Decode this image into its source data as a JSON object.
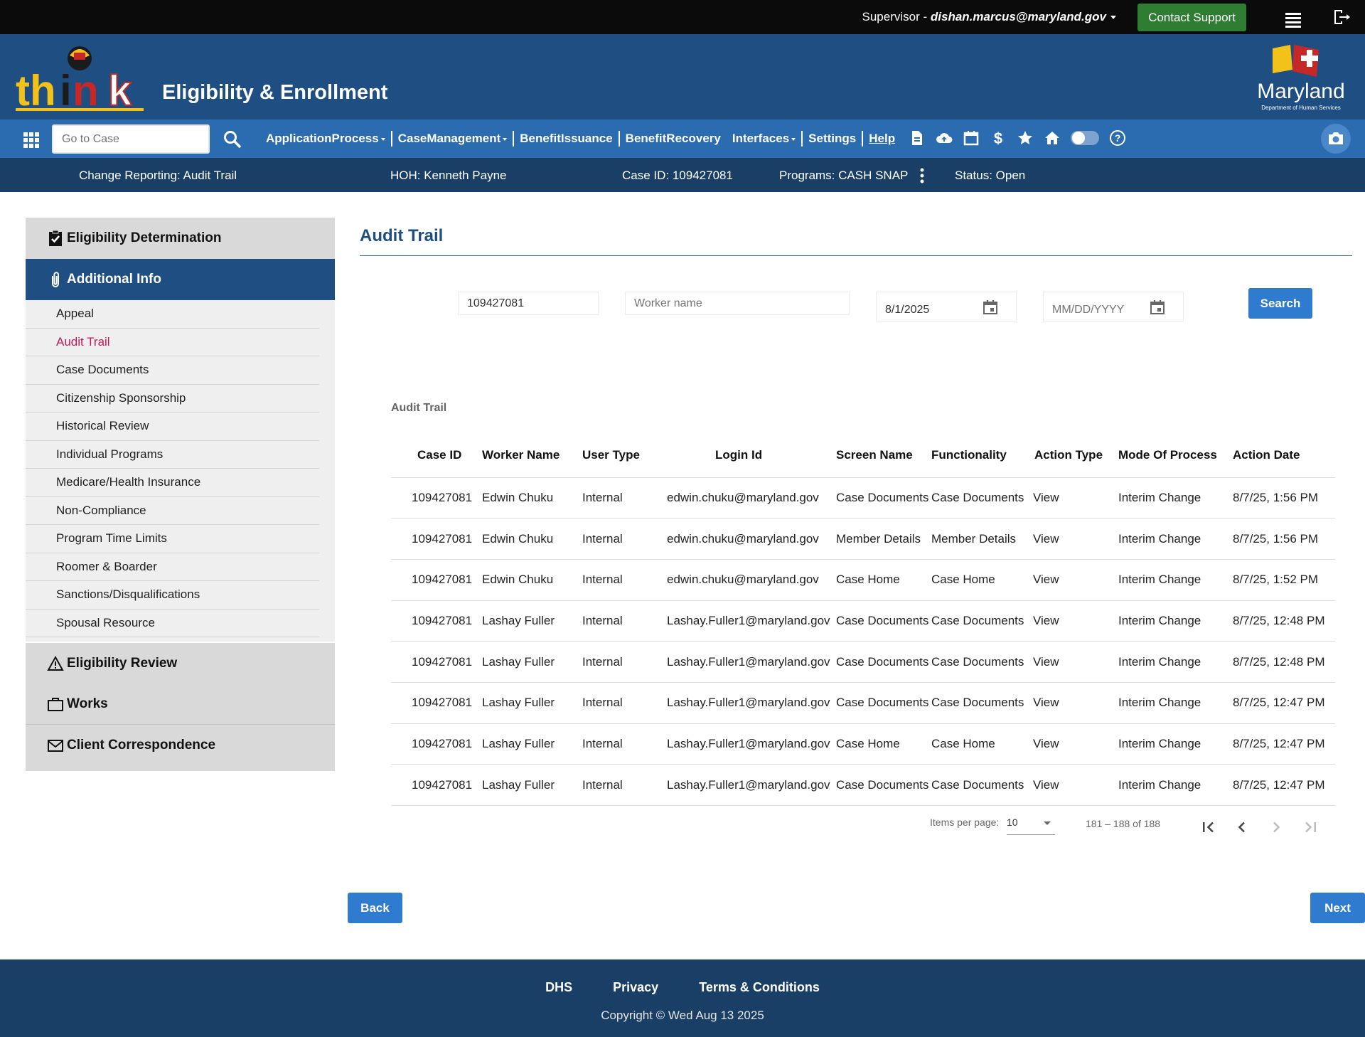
{
  "topbar": {
    "role_label": "Supervisor - ",
    "email": "dishan.marcus@maryland.gov",
    "contact_label": "Contact Support"
  },
  "header": {
    "title": "Eligibility & Enrollment",
    "logo_text": "think",
    "state_logo_text": "Maryland",
    "state_logo_subtext": "Department of Human Services"
  },
  "navbar": {
    "goto_placeholder": "Go to Case",
    "menu": [
      {
        "label": "ApplicationProcess"
      },
      {
        "label": "CaseManagement"
      },
      {
        "label": "BenefitIssuance"
      },
      {
        "label": "BenefitRecovery"
      },
      {
        "label": "Interfaces"
      },
      {
        "label": "Settings"
      },
      {
        "label": "Help"
      }
    ]
  },
  "casebar": {
    "page": "Change Reporting: Audit Trail",
    "hoh": "HOH: Kenneth Payne",
    "case_id": "Case ID: 109427081",
    "programs": "Programs: CASH  SNAP",
    "status": "Status: Open"
  },
  "sidebar": {
    "eligibility_determination": "Eligibility Determination",
    "additional_info": "Additional Info",
    "links": [
      "Appeal",
      "Audit Trail",
      "Case Documents",
      "Citizenship Sponsorship",
      "Historical Review",
      "Individual Programs",
      "Medicare/Health Insurance",
      "Non-Compliance",
      "Program Time Limits",
      "Roomer & Boarder",
      "Sanctions/Disqualifications",
      "Spousal Resource"
    ],
    "eligibility_review": "Eligibility Review",
    "works": "Works",
    "client_correspondence": "Client Correspondence"
  },
  "main": {
    "heading": "Audit Trail",
    "filters": {
      "case_id_value": "109427081",
      "worker_placeholder": "Worker name",
      "from_date_value": "8/1/2025",
      "to_date_placeholder": "MM/DD/YYYY",
      "search_label": "Search"
    },
    "table_label": "Audit Trail",
    "columns": [
      "Case ID",
      "Worker Name",
      "User Type",
      "Login Id",
      "Screen Name",
      "Functionality",
      "Action Type",
      "Mode Of Process",
      "Action Date"
    ],
    "rows": [
      [
        "109427081",
        "Edwin Chuku",
        "Internal",
        "edwin.chuku@maryland.gov",
        "Case Documents",
        "Case Documents",
        "View",
        "Interim Change",
        "8/7/25, 1:56 PM"
      ],
      [
        "109427081",
        "Edwin Chuku",
        "Internal",
        "edwin.chuku@maryland.gov",
        "Member Details",
        "Member Details",
        "View",
        "Interim Change",
        "8/7/25, 1:56 PM"
      ],
      [
        "109427081",
        "Edwin Chuku",
        "Internal",
        "edwin.chuku@maryland.gov",
        "Case Home",
        "Case Home",
        "View",
        "Interim Change",
        "8/7/25, 1:52 PM"
      ],
      [
        "109427081",
        "Lashay Fuller",
        "Internal",
        "Lashay.Fuller1@maryland.gov",
        "Case Documents",
        "Case Documents",
        "View",
        "Interim Change",
        "8/7/25, 12:48 PM"
      ],
      [
        "109427081",
        "Lashay Fuller",
        "Internal",
        "Lashay.Fuller1@maryland.gov",
        "Case Documents",
        "Case Documents",
        "View",
        "Interim Change",
        "8/7/25, 12:48 PM"
      ],
      [
        "109427081",
        "Lashay Fuller",
        "Internal",
        "Lashay.Fuller1@maryland.gov",
        "Case Documents",
        "Case Documents",
        "View",
        "Interim Change",
        "8/7/25, 12:47 PM"
      ],
      [
        "109427081",
        "Lashay Fuller",
        "Internal",
        "Lashay.Fuller1@maryland.gov",
        "Case Home",
        "Case Home",
        "View",
        "Interim Change",
        "8/7/25, 12:47 PM"
      ],
      [
        "109427081",
        "Lashay Fuller",
        "Internal",
        "Lashay.Fuller1@maryland.gov",
        "Case Documents",
        "Case Documents",
        "View",
        "Interim Change",
        "8/7/25, 12:47 PM"
      ]
    ],
    "paginator": {
      "items_per_page_label": "Items per page:",
      "items_per_page": "10",
      "range": "181 – 188 of 188"
    },
    "back_label": "Back",
    "next_label": "Next"
  },
  "footer": {
    "links": [
      "DHS",
      "Privacy",
      "Terms & Conditions"
    ],
    "copyright": "Copyright © Wed Aug 13 2025"
  },
  "colors": {
    "header_blue": "#1f4f82",
    "nav_blue": "#2b6cb0",
    "casebar_navy": "#1a3f66",
    "contact_green": "#2e7d32",
    "active_link": "#c2185b",
    "button_blue": "#2e7bcf"
  }
}
